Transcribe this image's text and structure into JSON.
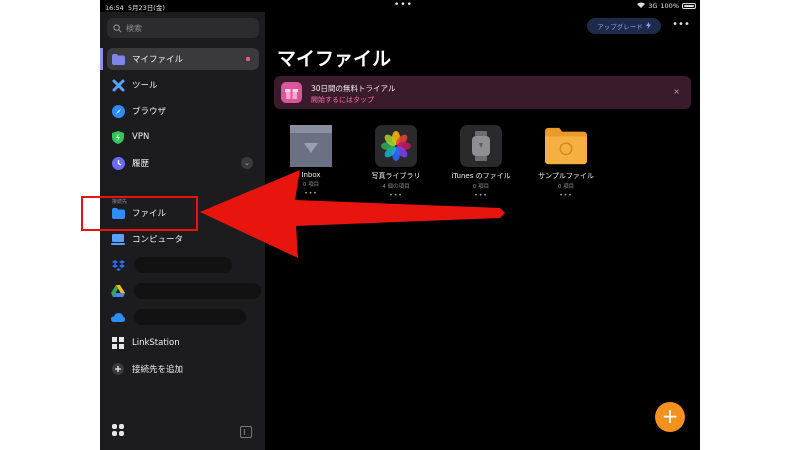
{
  "status_bar": {
    "time": "16:54",
    "date": "5月23日(金)",
    "center_dots": "•••",
    "network": "3G",
    "battery": "100%"
  },
  "sidebar": {
    "search_placeholder": "検索",
    "items": [
      {
        "label": "マイファイル",
        "icon": "folder-icon",
        "color": "#7d86e8"
      },
      {
        "label": "ツール",
        "icon": "tools-icon",
        "color": "#5aa0ff"
      },
      {
        "label": "ブラウザ",
        "icon": "compass-icon",
        "color": "#2f8cff"
      },
      {
        "label": "VPN",
        "icon": "shield-icon",
        "color": "#33c759"
      },
      {
        "label": "履歴",
        "icon": "clock-icon",
        "color": "#6b6bff"
      }
    ],
    "section_label": "接続先",
    "connections": [
      {
        "label": "ファイル",
        "icon": "folder-icon",
        "color": "#2f8cff"
      },
      {
        "label": "コンピュータ",
        "icon": "computer-icon",
        "color": "#5aa0ff"
      },
      {
        "label": "",
        "icon": "dropbox-icon",
        "color": "#2f6bff"
      },
      {
        "label": "",
        "icon": "google-drive-icon",
        "color": "#34a853"
      },
      {
        "label": "",
        "icon": "onedrive-icon",
        "color": "#2f8cff"
      },
      {
        "label": "LinkStation",
        "icon": "linkstation-icon",
        "color": "#e0e0e0"
      },
      {
        "label": "接続先を追加",
        "icon": "add-icon",
        "color": "#e0e0e0"
      }
    ]
  },
  "main": {
    "upgrade_label": "アップグレード",
    "more_label": "•••",
    "title": "マイファイル",
    "banner": {
      "line1": "30日間の無料トライアル",
      "line2": "開始するにはタップ",
      "close": "×"
    },
    "files": [
      {
        "name": "Inbox",
        "count": "0 項目",
        "more": "•••"
      },
      {
        "name": "写真ライブラリ",
        "count": "4 個の項目",
        "more": "•••"
      },
      {
        "name": "iTunes のファイル",
        "count": "0 項目",
        "more": "•••"
      },
      {
        "name": "サンプルファイル",
        "count": "0 項目",
        "more": "•••"
      }
    ],
    "fab_label": "+"
  },
  "colors": {
    "accent": "#f4901e",
    "highlight": "#e8150e"
  }
}
